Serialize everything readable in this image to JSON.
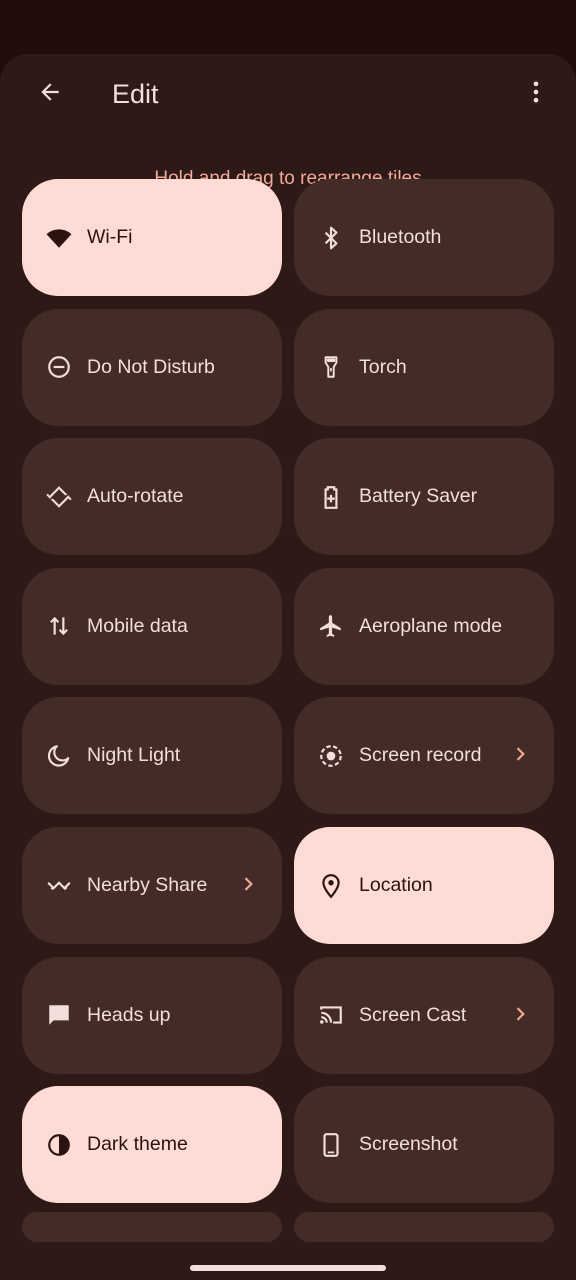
{
  "header": {
    "title": "Edit",
    "hint": "Hold and drag to rearrange tiles"
  },
  "colors": {
    "tile_on": "#fedbd4",
    "tile_off": "#432b27",
    "accent": "#f2a999",
    "background": "#2d1916"
  },
  "tiles": [
    {
      "label": "Wi-Fi",
      "icon": "wifi-icon",
      "active": true
    },
    {
      "label": "Bluetooth",
      "icon": "bluetooth-icon",
      "active": false
    },
    {
      "label": "Do Not Disturb",
      "icon": "do-not-disturb-icon",
      "active": false
    },
    {
      "label": "Torch",
      "icon": "torch-icon",
      "active": false
    },
    {
      "label": "Auto-rotate",
      "icon": "auto-rotate-icon",
      "active": false
    },
    {
      "label": "Battery Saver",
      "icon": "battery-saver-icon",
      "active": false
    },
    {
      "label": "Mobile data",
      "icon": "mobile-data-icon",
      "active": false
    },
    {
      "label": "Aeroplane mode",
      "icon": "airplane-icon",
      "active": false
    },
    {
      "label": "Night Light",
      "icon": "night-light-icon",
      "active": false
    },
    {
      "label": "Screen record",
      "icon": "screen-record-icon",
      "active": false,
      "chevron": true
    },
    {
      "label": "Nearby Share",
      "icon": "nearby-share-icon",
      "active": false,
      "chevron": true
    },
    {
      "label": "Location",
      "icon": "location-icon",
      "active": true
    },
    {
      "label": "Heads up",
      "icon": "heads-up-icon",
      "active": false
    },
    {
      "label": "Screen Cast",
      "icon": "screen-cast-icon",
      "active": false,
      "chevron": true
    },
    {
      "label": "Dark theme",
      "icon": "dark-theme-icon",
      "active": true
    },
    {
      "label": "Screenshot",
      "icon": "screenshot-icon",
      "active": false
    }
  ]
}
